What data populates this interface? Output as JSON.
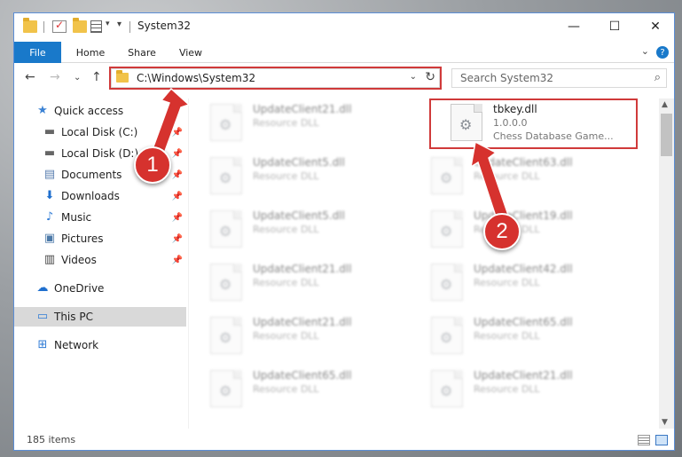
{
  "window": {
    "title": "System32",
    "minimize_glyph": "—",
    "maximize_glyph": "☐",
    "close_glyph": "✕"
  },
  "ribbon": {
    "tabs": [
      {
        "label": "File"
      },
      {
        "label": "Home"
      },
      {
        "label": "Share"
      },
      {
        "label": "View"
      }
    ],
    "help_glyph": "?"
  },
  "address": {
    "path": "C:\\Windows\\System32",
    "search_placeholder": "Search System32"
  },
  "nav_pane": {
    "items": [
      {
        "label": "Quick access",
        "icon": "star-icon"
      },
      {
        "label": "Local Disk (C:)",
        "icon": "drive-icon",
        "pinned": true
      },
      {
        "label": "Local Disk (D:)",
        "icon": "drive-icon",
        "pinned": true
      },
      {
        "label": "Documents",
        "icon": "documents-icon",
        "pinned": true
      },
      {
        "label": "Downloads",
        "icon": "download-icon",
        "pinned": true
      },
      {
        "label": "Music",
        "icon": "music-icon",
        "pinned": true
      },
      {
        "label": "Pictures",
        "icon": "pictures-icon",
        "pinned": true
      },
      {
        "label": "Videos",
        "icon": "videos-icon",
        "pinned": true
      },
      {
        "label": "OneDrive",
        "icon": "cloud-icon"
      },
      {
        "label": "This PC",
        "icon": "computer-icon",
        "selected": true
      },
      {
        "label": "Network",
        "icon": "network-icon"
      }
    ]
  },
  "files": {
    "highlighted": {
      "name": "tbkey.dll",
      "version": "1.0.0.0",
      "description": "Chess Database Game..."
    },
    "blurred": [
      {
        "name": "UpdateClient21.dll",
        "type": "Resource DLL"
      },
      {
        "name": "UpdateClient5.dll",
        "type": "Resource DLL"
      },
      {
        "name": "UpdateClient63.dll",
        "type": "Resource DLL"
      },
      {
        "name": "UpdateClient5.dll",
        "type": "Resource DLL"
      },
      {
        "name": "UpdateClient19.dll",
        "type": "Resource DLL"
      },
      {
        "name": "UpdateClient21.dll",
        "type": "Resource DLL"
      },
      {
        "name": "UpdateClient42.dll",
        "type": "Resource DLL"
      },
      {
        "name": "UpdateClient21.dll",
        "type": "Resource DLL"
      },
      {
        "name": "UpdateClient65.dll",
        "type": "Resource DLL"
      },
      {
        "name": "UpdateClient65.dll",
        "type": "Resource DLL"
      },
      {
        "name": "UpdateClient21.dll",
        "type": "Resource DLL"
      }
    ]
  },
  "status": {
    "item_count": "185 items"
  },
  "callouts": {
    "step1": "1",
    "step2": "2",
    "color": "#d6322e"
  }
}
